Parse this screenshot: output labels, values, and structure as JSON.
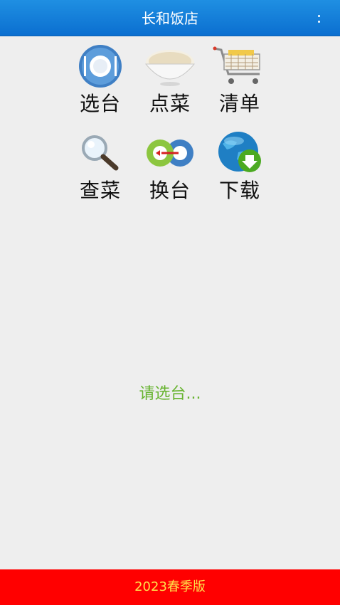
{
  "header": {
    "title": "长和饭店",
    "menu_icon": "overflow-menu-icon"
  },
  "menu": {
    "items": [
      {
        "label": "选台",
        "icon": "table-plate-icon"
      },
      {
        "label": "点菜",
        "icon": "rice-bowl-icon"
      },
      {
        "label": "清单",
        "icon": "shopping-cart-icon"
      },
      {
        "label": "查菜",
        "icon": "magnifier-icon"
      },
      {
        "label": "换台",
        "icon": "swap-table-icon"
      },
      {
        "label": "下载",
        "icon": "globe-download-icon"
      }
    ]
  },
  "status": {
    "text": "请选台..."
  },
  "footer": {
    "text": "2023春季版"
  },
  "colors": {
    "header": "#0b6fd0",
    "status": "#66b32e",
    "footer_bg": "#ff0000",
    "footer_text": "#ffe04a"
  }
}
